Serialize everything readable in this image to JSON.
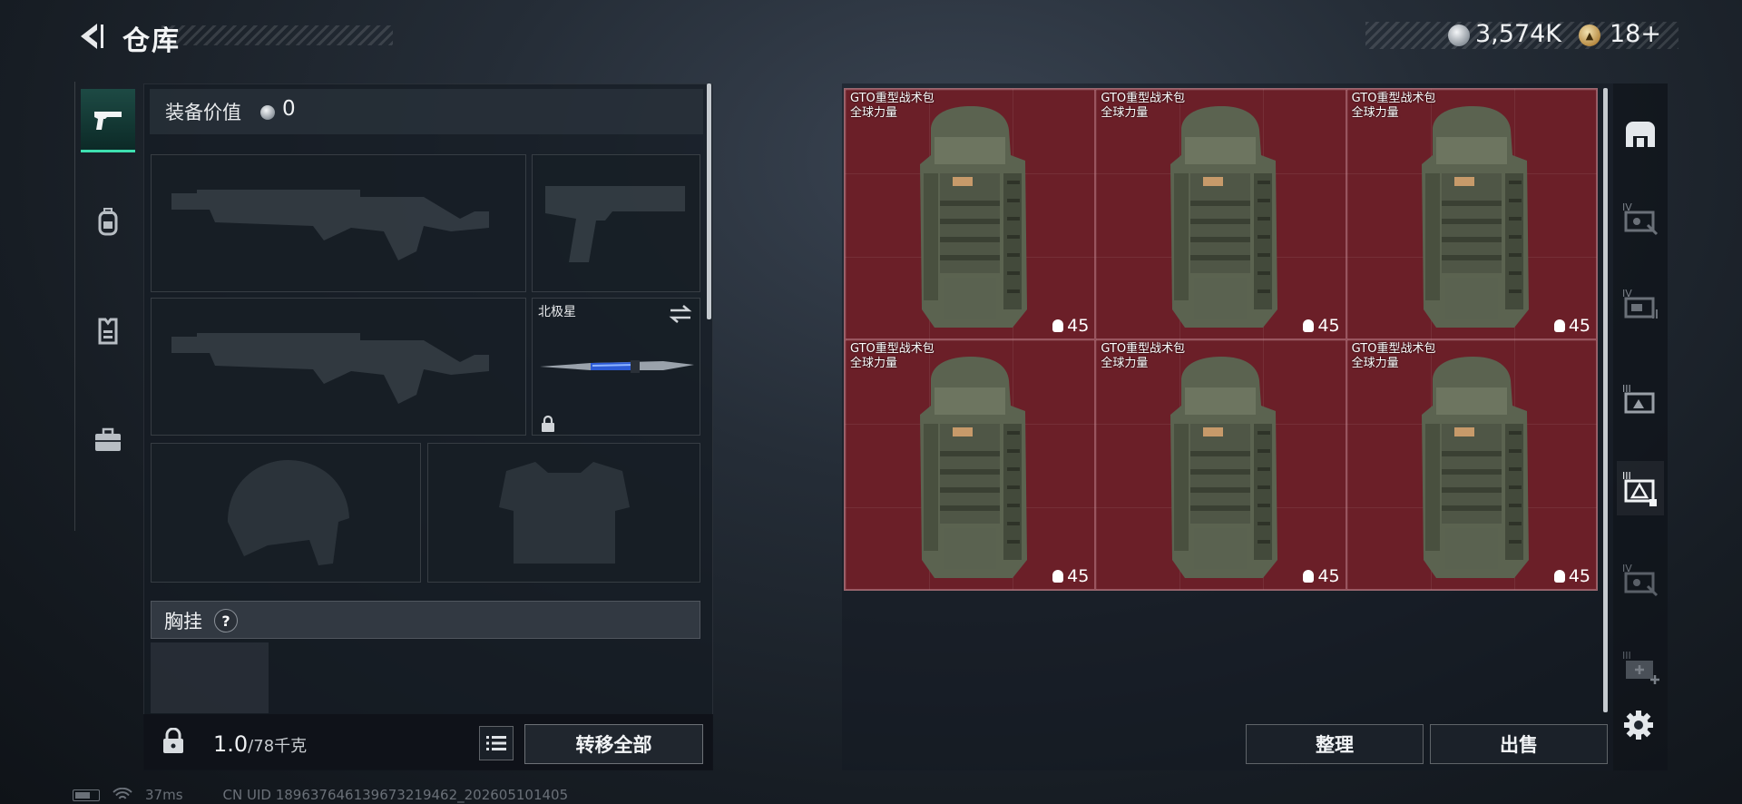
{
  "header": {
    "title": "仓库",
    "currency_amount": "3,574K",
    "coin_amount": "18+"
  },
  "left_tabs": [
    {
      "icon": "pistol-icon",
      "active": true
    },
    {
      "icon": "backpack-icon",
      "active": false
    },
    {
      "icon": "vest-icon",
      "active": false
    },
    {
      "icon": "briefcase-icon",
      "active": false
    }
  ],
  "equipment": {
    "value_label": "装备价值",
    "value": "0",
    "melee_slot_label": "北极星",
    "chest_label": "胸挂",
    "chest_help": "?",
    "weight_value": "1.0",
    "weight_max": "/78千克",
    "transfer_all_label": "转移全部"
  },
  "stash": {
    "items": [
      {
        "name": "GTO重型战术包",
        "subtitle": "全球力量",
        "count": "45"
      },
      {
        "name": "GTO重型战术包",
        "subtitle": "全球力量",
        "count": "45"
      },
      {
        "name": "GTO重型战术包",
        "subtitle": "全球力量",
        "count": "45"
      },
      {
        "name": "GTO重型战术包",
        "subtitle": "全球力量",
        "count": "45"
      },
      {
        "name": "GTO重型战术包",
        "subtitle": "全球力量",
        "count": "45"
      },
      {
        "name": "GTO重型战术包",
        "subtitle": "全球力量",
        "count": "45"
      }
    ],
    "sort_label": "整理",
    "sell_label": "出售"
  },
  "right_tabs": [
    {
      "icon": "safe-box-icon"
    },
    {
      "icon": "container-iv-icon",
      "tier": "IV"
    },
    {
      "icon": "container-iv-2-icon",
      "tier": "IV"
    },
    {
      "icon": "container-iii-icon",
      "tier": "III"
    },
    {
      "icon": "container-ii-icon",
      "tier": "II",
      "active": true
    },
    {
      "icon": "container-iv-3-icon",
      "tier": "IV"
    },
    {
      "icon": "add-container-icon",
      "tier": "III"
    }
  ],
  "footer": {
    "ping": "37ms",
    "uid": "CN UID 1896376461396732194​62_202605101405"
  },
  "colors": {
    "accent": "#3ee0b0",
    "stash_bg": "#6a1f27"
  }
}
